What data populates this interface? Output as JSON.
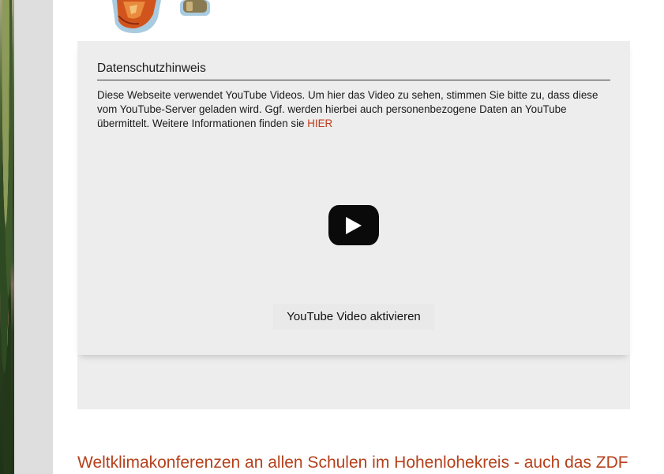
{
  "consent": {
    "title": "Datenschutzhinweis",
    "text": "Diese Webseite verwendet YouTube Videos. Um hier das Video zu sehen, stimmen Sie bitte zu, dass diese vom YouTube-Server geladen wird. Ggf. werden hierbei auch personenbezogene Daten an YouTube übermittelt. Weitere Informationen finden sie ",
    "link_label": "HIER",
    "play_icon": "youtube-play-icon",
    "activate_label": "YouTube Video aktivieren"
  },
  "article": {
    "headline": "Weltklimakonferenzen an allen Schulen im Hohenlohekreis - auch das ZDF"
  },
  "colors": {
    "panel_bg": "#ededed",
    "link": "#c23a1a",
    "headline": "#b5401b",
    "sidebar": "#dedede"
  }
}
